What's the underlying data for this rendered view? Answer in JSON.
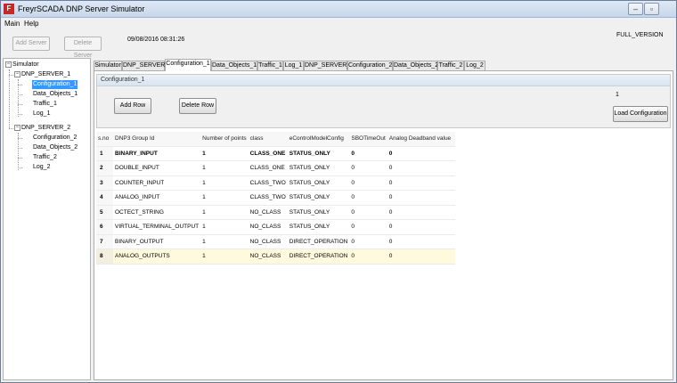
{
  "window": {
    "title": "FreyrSCADA DNP Server Simulator",
    "icon": "app-logo-icon",
    "minimize": "–",
    "maximize": "▫",
    "close": "✕"
  },
  "menu": {
    "items": [
      "Main",
      "Help"
    ]
  },
  "toolbar": {
    "add_server": "Add Server",
    "delete_server": "Delete Server",
    "datetime": "09/08/2016 08:31:26",
    "version": "FULL_VERSION"
  },
  "tree": {
    "root": "Simulator",
    "servers": [
      {
        "label": "DNP_SERVER_1",
        "children": [
          "Configuration_1",
          "Data_Objects_1",
          "Traffic_1",
          "Log_1"
        ]
      },
      {
        "label": "DNP_SERVER_2",
        "children": [
          "Configuration_2",
          "Data_Objects_2",
          "Traffic_2",
          "Log_2"
        ]
      }
    ],
    "selected": "Configuration_1"
  },
  "tabs": [
    "Simulator",
    "DNP_SERVER_1",
    "Configuration_1",
    "Data_Objects_1",
    "Traffic_1",
    "Log_1",
    "DNP_SERVER_2",
    "Configuration_2",
    "Data_Objects_2",
    "Traffic_2",
    "Log_2"
  ],
  "active_tab": "Configuration_1",
  "config": {
    "group_title": "Configuration_1",
    "add_row": "Add Row",
    "delete_row": "Delete Row",
    "load_configuration": "Load Configuration",
    "count": "1"
  },
  "table": {
    "columns": [
      "s.no",
      "DNP3 Group Id",
      "Number of points",
      "class",
      "eControlModelConfig",
      "SBOTimeOut",
      "Analog Deadband value"
    ],
    "rows": [
      [
        "1",
        "BINARY_INPUT",
        "1",
        "CLASS_ONE",
        "STATUS_ONLY",
        "0",
        "0"
      ],
      [
        "2",
        "DOUBLE_INPUT",
        "1",
        "CLASS_ONE",
        "STATUS_ONLY",
        "0",
        "0"
      ],
      [
        "3",
        "COUNTER_INPUT",
        "1",
        "CLASS_TWO",
        "STATUS_ONLY",
        "0",
        "0"
      ],
      [
        "4",
        "ANALOG_INPUT",
        "1",
        "CLASS_TWO",
        "STATUS_ONLY",
        "0",
        "0"
      ],
      [
        "5",
        "OCTECT_STRING",
        "1",
        "NO_CLASS",
        "STATUS_ONLY",
        "0",
        "0"
      ],
      [
        "6",
        "VIRTUAL_TERMINAL_OUTPUT",
        "1",
        "NO_CLASS",
        "STATUS_ONLY",
        "0",
        "0"
      ],
      [
        "7",
        "BINARY_OUTPUT",
        "1",
        "NO_CLASS",
        "DIRECT_OPERATION",
        "0",
        "0"
      ],
      [
        "8",
        "ANALOG_OUTPUTS",
        "1",
        "NO_CLASS",
        "DIRECT_OPERATION",
        "0",
        "0"
      ]
    ],
    "bold_row": 0,
    "highlight_row": 7
  },
  "colors": {
    "selection": "#3399ff",
    "highlight_row": "#fff9dd",
    "close_button": "#c74a2e"
  }
}
